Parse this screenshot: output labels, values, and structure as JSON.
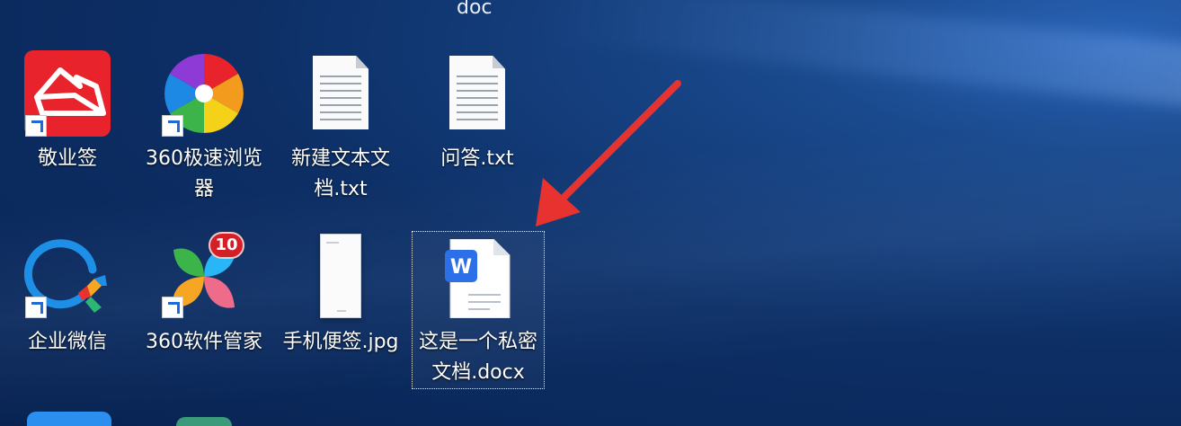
{
  "window": {
    "title": "doc"
  },
  "desktop": {
    "icons": [
      {
        "label": "敬业签",
        "icon": "jingyeqian-app-icon",
        "shortcut": true,
        "color": "#e8232b"
      },
      {
        "label": "360极速浏览\n器",
        "icon": "360-browser-icon",
        "shortcut": true
      },
      {
        "label": "新建文本文\n档.txt",
        "icon": "text-file-icon",
        "shortcut": false
      },
      {
        "label": "问答.txt",
        "icon": "text-file-icon",
        "shortcut": false
      },
      {
        "label": "企业微信",
        "icon": "wecom-icon",
        "shortcut": true
      },
      {
        "label": "360软件管家",
        "icon": "360-software-manager-icon",
        "shortcut": true,
        "badge": "10"
      },
      {
        "label": "手机便签.jpg",
        "icon": "image-file-icon",
        "shortcut": false
      },
      {
        "label": "这是一个私密\n文档.docx",
        "icon": "wps-word-doc-icon",
        "shortcut": false,
        "selected": true
      }
    ]
  },
  "annotation": {
    "type": "red-arrow",
    "color": "#e8322f",
    "points_to": "这是一个私密文档.docx"
  }
}
